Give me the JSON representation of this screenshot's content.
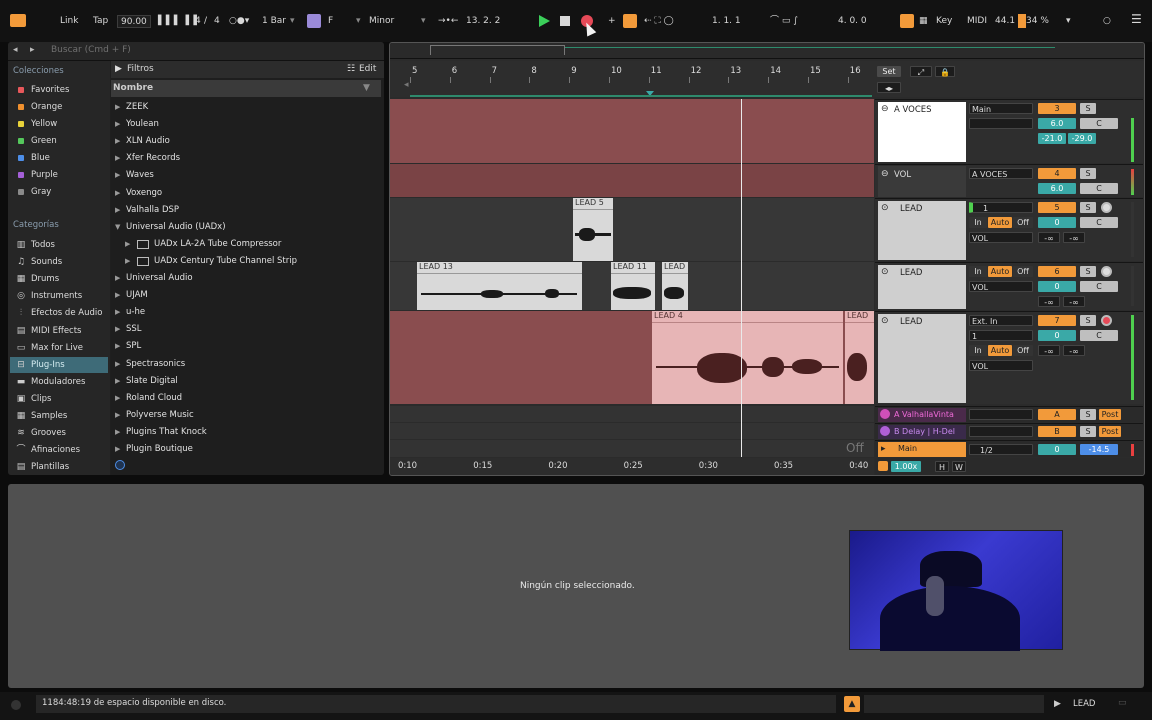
{
  "transport": {
    "link": "Link",
    "tap": "Tap",
    "tempo": "90.00",
    "time_sig_num": "4",
    "time_sig_sep": "/",
    "time_sig_den": "4",
    "quantize": "1 Bar",
    "key_root": "F",
    "scale": "Minor",
    "position": "13.   2.   2",
    "loop_start": "1.   1.   1",
    "loop_length": "4.   0.   0",
    "key_label": "Key",
    "midi_label": "MIDI",
    "sample_rate": "44.1",
    "cpu": "34 %"
  },
  "browser": {
    "search_placeholder": "Buscar (Cmd + F)",
    "filter_label": "Filtros",
    "edit_label": "Edit",
    "name_header": "Nombre",
    "collections_title": "Colecciones",
    "collections": [
      {
        "label": "Favorites",
        "color": "#e8585b"
      },
      {
        "label": "Orange",
        "color": "#f0902e"
      },
      {
        "label": "Yellow",
        "color": "#e8d23a"
      },
      {
        "label": "Green",
        "color": "#55c75c"
      },
      {
        "label": "Blue",
        "color": "#4d8ee8"
      },
      {
        "label": "Purple",
        "color": "#a560d8"
      },
      {
        "label": "Gray",
        "color": "#8a8a8a"
      }
    ],
    "categories_title": "Categorías",
    "categories": [
      {
        "label": "Todos",
        "icon": "grid-icon"
      },
      {
        "label": "Sounds",
        "icon": "sound-icon"
      },
      {
        "label": "Drums",
        "icon": "drum-icon"
      },
      {
        "label": "Instruments",
        "icon": "instrument-icon"
      },
      {
        "label": "Efectos de Audio",
        "icon": "audio-fx-icon"
      },
      {
        "label": "MIDI Effects",
        "icon": "midi-fx-icon"
      },
      {
        "label": "Max for Live",
        "icon": "max-icon"
      },
      {
        "label": "Plug-Ins",
        "icon": "plugin-icon"
      },
      {
        "label": "Moduladores",
        "icon": "modulator-icon"
      },
      {
        "label": "Clips",
        "icon": "clip-icon"
      },
      {
        "label": "Samples",
        "icon": "sample-icon"
      },
      {
        "label": "Grooves",
        "icon": "groove-icon"
      },
      {
        "label": "Afinaciones",
        "icon": "tuning-icon"
      },
      {
        "label": "Plantillas",
        "icon": "template-icon"
      }
    ],
    "files": [
      {
        "label": "ZEEK",
        "depth": 0,
        "arrow": "▶"
      },
      {
        "label": "Youlean",
        "depth": 0,
        "arrow": "▶"
      },
      {
        "label": "XLN Audio",
        "depth": 0,
        "arrow": "▶"
      },
      {
        "label": "Xfer Records",
        "depth": 0,
        "arrow": "▶"
      },
      {
        "label": "Waves",
        "depth": 0,
        "arrow": "▶"
      },
      {
        "label": "Voxengo",
        "depth": 0,
        "arrow": "▶"
      },
      {
        "label": "Valhalla DSP",
        "depth": 0,
        "arrow": "▶"
      },
      {
        "label": "Universal Audio (UADx)",
        "depth": 0,
        "arrow": "▼"
      },
      {
        "label": "UADx LA-2A Tube Compressor",
        "depth": 1,
        "arrow": "▶"
      },
      {
        "label": "UADx Century Tube Channel Strip",
        "depth": 1,
        "arrow": "▶"
      },
      {
        "label": "Universal Audio",
        "depth": 0,
        "arrow": "▶"
      },
      {
        "label": "UJAM",
        "depth": 0,
        "arrow": "▶"
      },
      {
        "label": "u-he",
        "depth": 0,
        "arrow": "▶"
      },
      {
        "label": "SSL",
        "depth": 0,
        "arrow": "▶"
      },
      {
        "label": "SPL",
        "depth": 0,
        "arrow": "▶"
      },
      {
        "label": "Spectrasonics",
        "depth": 0,
        "arrow": "▶"
      },
      {
        "label": "Slate Digital",
        "depth": 0,
        "arrow": "▶"
      },
      {
        "label": "Roland Cloud",
        "depth": 0,
        "arrow": "▶"
      },
      {
        "label": "Polyverse Music",
        "depth": 0,
        "arrow": "▶"
      },
      {
        "label": "Plugins That Knock",
        "depth": 0,
        "arrow": "▶"
      },
      {
        "label": "Plugin Boutique",
        "depth": 0,
        "arrow": "▶"
      }
    ]
  },
  "arrangement": {
    "bars": [
      "5",
      "6",
      "7",
      "8",
      "9",
      "10",
      "11",
      "12",
      "13",
      "14",
      "15",
      "16"
    ],
    "times": [
      "0:10",
      "0:15",
      "0:20",
      "0:25",
      "0:30",
      "0:35",
      "0:40"
    ],
    "set_label": "Set",
    "off_label": "Off",
    "clips": {
      "lead5": "LEAD 5",
      "lead13": "LEAD 13",
      "lead11": "LEAD 11",
      "lead_small": "LEAD",
      "lead4": "LEAD 4",
      "lead_end": "LEAD"
    },
    "tracks": [
      {
        "name": "A VOCES",
        "routing": "Main",
        "num": "3",
        "vol": "6.0",
        "pan": "C",
        "peak1": "-21.0",
        "peak2": "-29.0",
        "solo": "S"
      },
      {
        "name": "VOL",
        "routing": "A VOCES",
        "num": "4",
        "vol": "6.0",
        "pan": "C",
        "solo": "S"
      },
      {
        "name": "LEAD",
        "routing": "1",
        "num": "5",
        "vol": "0",
        "pan": "C",
        "in": "In",
        "auto": "Auto",
        "off": "Off",
        "param": "VOL",
        "inf1": "-∞",
        "inf2": "-∞",
        "solo": "S"
      },
      {
        "name": "LEAD",
        "routing": "",
        "num": "6",
        "vol": "0",
        "pan": "C",
        "in": "In",
        "auto": "Auto",
        "off": "Off",
        "param": "VOL",
        "inf1": "-∞",
        "inf2": "-∞",
        "solo": "S"
      },
      {
        "name": "LEAD",
        "routing": "Ext. In",
        "routing2": "1",
        "num": "7",
        "vol": "0",
        "pan": "C",
        "in": "In",
        "auto": "Auto",
        "off": "Off",
        "param": "VOL",
        "inf1": "-∞",
        "inf2": "-∞",
        "solo": "S"
      }
    ],
    "returns": [
      {
        "name": "A ValhallaVintа",
        "letter": "A",
        "solo": "S",
        "post": "Post"
      },
      {
        "name": "B Delay | H-Del",
        "letter": "B",
        "solo": "S",
        "post": "Post"
      }
    ],
    "main": {
      "name": "Main",
      "routing": "1/2",
      "num": "0",
      "vol": "-14.5",
      "zoom": "1.00x",
      "h": "H",
      "w": "W"
    }
  },
  "detail": {
    "empty_text": "Ningún clip seleccionado."
  },
  "status": {
    "disk_text": "1184:48:19 de espacio disponible en disco.",
    "track_label": "LEAD"
  }
}
